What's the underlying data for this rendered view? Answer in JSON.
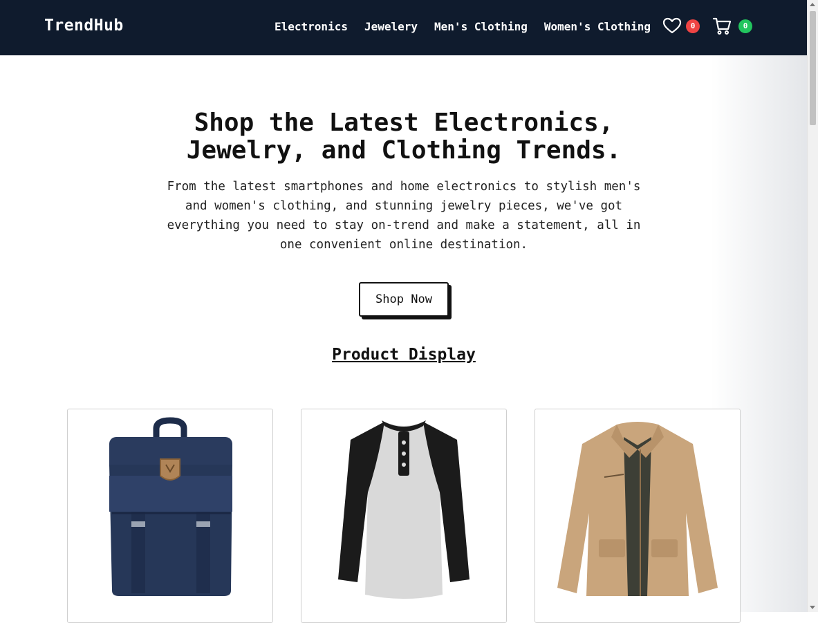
{
  "header": {
    "brand": "TrendHub",
    "nav": [
      "Electronics",
      "Jewelery",
      "Men's Clothing",
      "Women's Clothing"
    ],
    "wishlist_count": "0",
    "cart_count": "0",
    "icons": [
      "heart-icon",
      "cart-icon"
    ]
  },
  "hero": {
    "title": "Shop the Latest Electronics, Jewelry, and Clothing Trends.",
    "description": "From the latest smartphones and home electronics to stylish men's and women's clothing, and stunning jewelry pieces, we've got everything you need to stay on-trend and make a statement, all in one convenient online destination.",
    "cta": "Shop Now"
  },
  "products": {
    "heading": "Product Display"
  },
  "colors": {
    "nav_bg": "#0f1b2d",
    "wishlist_badge": "#ef4444",
    "cart_badge": "#22c55e"
  }
}
